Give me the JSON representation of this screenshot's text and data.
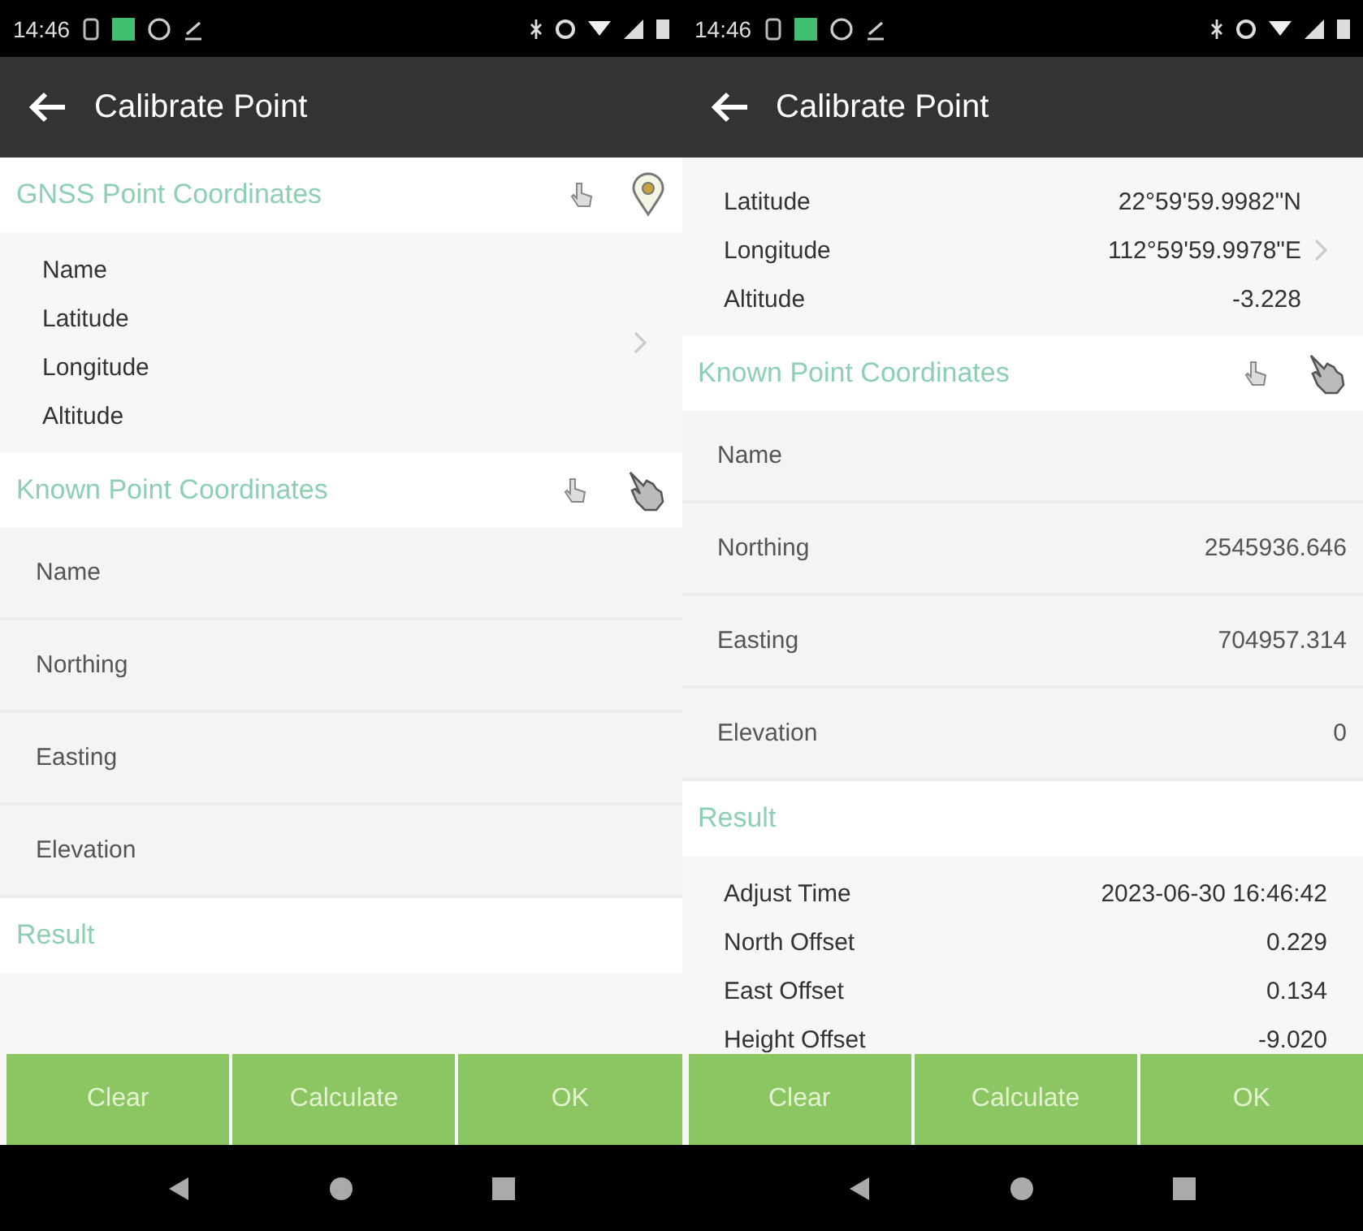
{
  "screens": [
    {
      "status_time": "14:46",
      "title": "Calibrate Point",
      "sections": [
        {
          "kind": "gnss",
          "title": "GNSS Point Coordinates",
          "rows": [
            {
              "label": "Name"
            },
            {
              "label": "Latitude"
            },
            {
              "label": "Longitude"
            },
            {
              "label": "Altitude"
            }
          ]
        },
        {
          "kind": "known",
          "title": "Known Point Coordinates",
          "rows": [
            {
              "label": "Name"
            },
            {
              "label": "Northing"
            },
            {
              "label": "Easting"
            },
            {
              "label": "Elevation"
            }
          ]
        },
        {
          "kind": "result",
          "title": "Result"
        }
      ],
      "buttons": [
        "Clear",
        "Calculate",
        "OK"
      ]
    },
    {
      "status_time": "14:46",
      "title": "Calibrate Point",
      "sections": [
        {
          "kind": "gnss",
          "rows": [
            {
              "label": "Latitude",
              "value": "22°59'59.9982\"N"
            },
            {
              "label": "Longitude",
              "value": "112°59'59.9978\"E"
            },
            {
              "label": "Altitude",
              "value": "-3.228"
            }
          ]
        },
        {
          "kind": "known",
          "title": "Known Point Coordinates",
          "rows": [
            {
              "label": "Name"
            },
            {
              "label": "Northing",
              "value": "2545936.646"
            },
            {
              "label": "Easting",
              "value": "704957.314"
            },
            {
              "label": "Elevation",
              "value": "0"
            }
          ]
        },
        {
          "kind": "result",
          "title": "Result",
          "rows": [
            {
              "label": "Adjust Time",
              "value": "2023-06-30 16:46:42"
            },
            {
              "label": "North Offset",
              "value": "0.229"
            },
            {
              "label": "East Offset",
              "value": "0.134"
            },
            {
              "label": "Height Offset",
              "value": "-9.020"
            }
          ]
        }
      ],
      "buttons": [
        "Clear",
        "Calculate",
        "OK"
      ]
    }
  ]
}
